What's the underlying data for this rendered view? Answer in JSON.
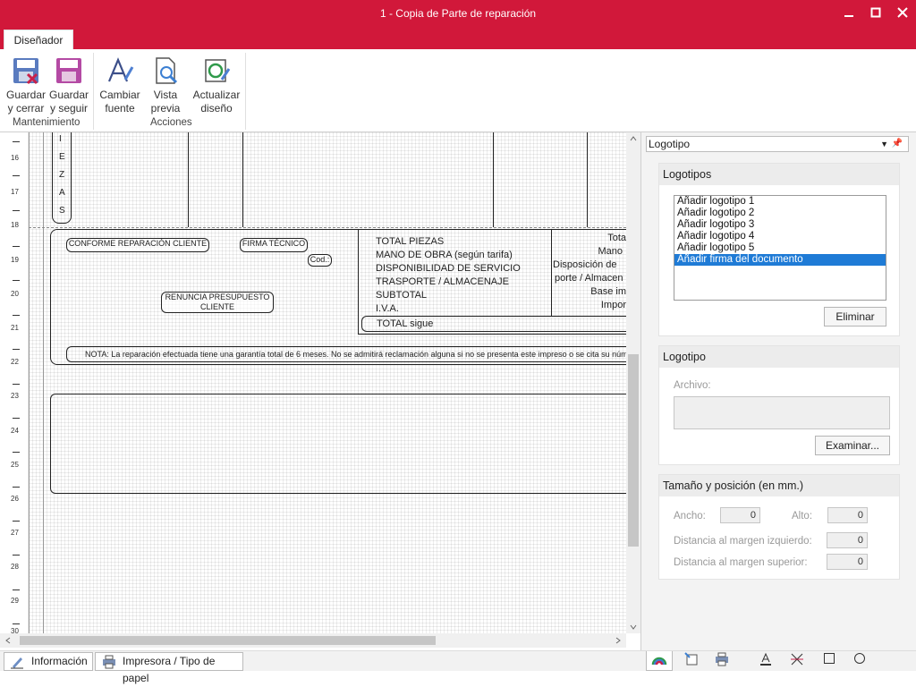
{
  "window": {
    "title": "1 - Copia de Parte de reparación"
  },
  "ribbon": {
    "active_tab": "Diseñador",
    "buttons": [
      {
        "line1": "Guardar",
        "line2": "y cerrar",
        "icon": "save-close-icon"
      },
      {
        "line1": "Guardar",
        "line2": "y seguir",
        "icon": "save-icon"
      },
      {
        "line1": "Cambiar",
        "line2": "fuente",
        "icon": "font-icon"
      },
      {
        "line1": "Vista",
        "line2": "previa",
        "icon": "preview-icon"
      },
      {
        "line1": "Actualizar",
        "line2": "diseño",
        "icon": "refresh-design-icon"
      }
    ],
    "groups": {
      "maintenance": "Mantenimiento",
      "actions": "Acciones"
    }
  },
  "designer": {
    "ruler": [
      "16",
      "17",
      "18",
      "19",
      "20",
      "21",
      "22",
      "23",
      "24",
      "25",
      "26",
      "27",
      "28",
      "29",
      "30"
    ],
    "piezas_letters": [
      "I",
      "E",
      "Z",
      "A",
      "S"
    ],
    "labels": {
      "conforme": "CONFORME REPARACIÓN CLIENTE",
      "firma_tecnico": "FIRMA TÉCNICO",
      "cod": "Cod.:",
      "renuncia_1": "RENUNCIA PRESUPUESTO",
      "renuncia_2": "CLIENTE",
      "nota": "NOTA: La reparación efectuada tiene una garantía total de 6 meses. No se admitirá reclamación alguna si no se presenta   este impreso o se cita su núm"
    },
    "totals": [
      "TOTAL PIEZAS",
      "MANO DE OBRA (según tarifa)",
      "DISPONIBILIDAD DE SERVICIO",
      "TRASPORTE / ALMACENAJE",
      "SUBTOTAL",
      "I.V.A."
    ],
    "total_sigue": "TOTAL sigue",
    "right_cut": [
      "Tota",
      "Mano",
      "Disposición de",
      "porte / Almacen",
      "Base im",
      "Impor"
    ]
  },
  "panel": {
    "header": "Logotipo",
    "logotipos": {
      "title": "Logotipos",
      "items": [
        "Añadir logotipo 1",
        "Añadir logotipo 2",
        "Añadir logotipo 3",
        "Añadir logotipo 4",
        "Añadir logotipo 5",
        "Añadir firma del documento"
      ],
      "selected_index": 5,
      "remove_label": "Eliminar"
    },
    "logotipo": {
      "title": "Logotipo",
      "file_label": "Archivo:",
      "file_value": "",
      "browse_label": "Examinar..."
    },
    "size": {
      "title": "Tamaño y posición (en mm.)",
      "width_label": "Ancho:",
      "width_value": "0",
      "height_label": "Alto:",
      "height_value": "0",
      "left_label": "Distancia al margen izquierdo:",
      "left_value": "0",
      "top_label": "Distancia al margen superior:",
      "top_value": "0"
    }
  },
  "bottom": {
    "info_tab": "Información",
    "printer_tab": "Impresora / Tipo de papel",
    "panel_tab_icons": [
      "palette-icon",
      "layout-icon",
      "printer-icon",
      "text-icon",
      "line-icon",
      "rectangle-icon",
      "circle-icon"
    ]
  },
  "colors": {
    "accent": "#d1183a",
    "selection": "#1f7bd6"
  }
}
